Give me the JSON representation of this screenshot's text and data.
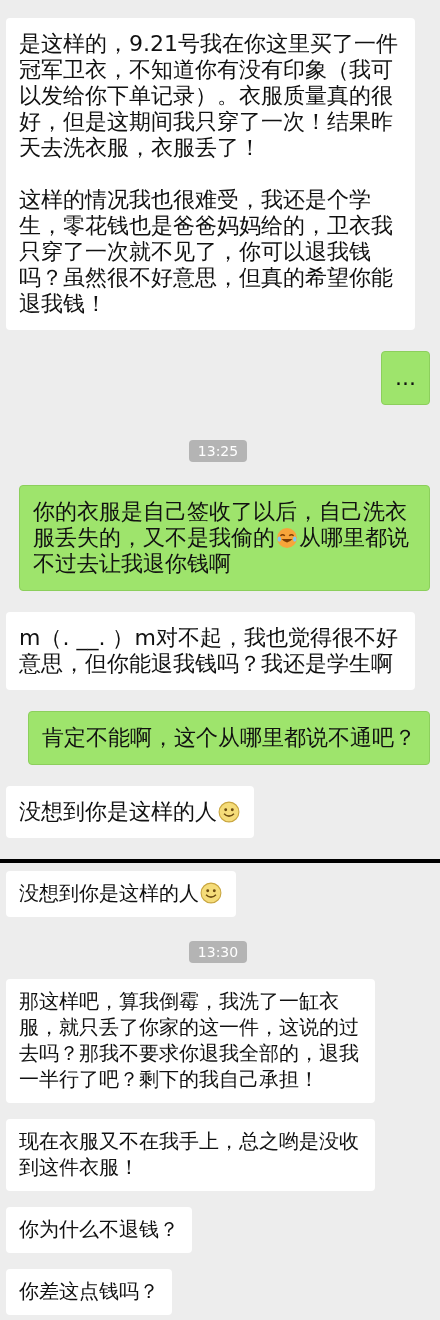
{
  "screens": [
    {
      "messages": [
        {
          "kind": "received",
          "paragraphs": [
            "是这样的，9.21号我在你这里买了一件冠军卫衣，不知道你有没有印象（我可以发给你下单记录）。衣服质量真的很好，但是这期间我只穿了一次！结果昨天去洗衣服，衣服丢了！",
            "这样的情况我也很难受，我还是个学生，零花钱也是爸爸妈妈给的，卫衣我只穿了一次就不见了，你可以退我钱吗？虽然很不好意思，但真的希望你能退我钱！"
          ]
        },
        {
          "kind": "sent",
          "paragraphs": [
            "..."
          ]
        },
        {
          "kind": "time",
          "text": "13:25"
        },
        {
          "kind": "sent",
          "parts": [
            {
              "kind": "text",
              "text": "你的衣服是自己签收了以后，自己洗衣服丢失的，又不是我偷的"
            },
            {
              "kind": "laugh-emoji"
            },
            {
              "kind": "text",
              "text": "从哪里都说不过去让我退你钱啊"
            }
          ]
        },
        {
          "kind": "received",
          "paragraphs": [
            "m（. __. ）m对不起，我也觉得很不好意思，但你能退我钱吗？我还是学生啊"
          ]
        },
        {
          "kind": "sent",
          "paragraphs": [
            "肯定不能啊，这个从哪里都说不通吧？"
          ]
        },
        {
          "kind": "received",
          "parts": [
            {
              "kind": "text",
              "text": "没想到你是这样的人"
            },
            {
              "kind": "smile-emoji"
            }
          ]
        }
      ]
    },
    {
      "messages": [
        {
          "kind": "received",
          "parts": [
            {
              "kind": "text",
              "text": "没想到你是这样的人"
            },
            {
              "kind": "smile-emoji"
            }
          ]
        },
        {
          "kind": "time",
          "text": "13:30"
        },
        {
          "kind": "received",
          "paragraphs": [
            "那这样吧，算我倒霉，我洗了一缸衣服，就只丢了你家的这一件，这说的过去吗？那我不要求你退我全部的，退我一半行了吧？剩下的我自己承担！"
          ]
        },
        {
          "kind": "received",
          "paragraphs": [
            "现在衣服又不在我手上，总之哟是没收到这件衣服！"
          ]
        },
        {
          "kind": "received",
          "paragraphs": [
            "你为什么不退钱？"
          ]
        },
        {
          "kind": "received",
          "paragraphs": [
            "你差这点钱吗？"
          ]
        }
      ]
    }
  ]
}
